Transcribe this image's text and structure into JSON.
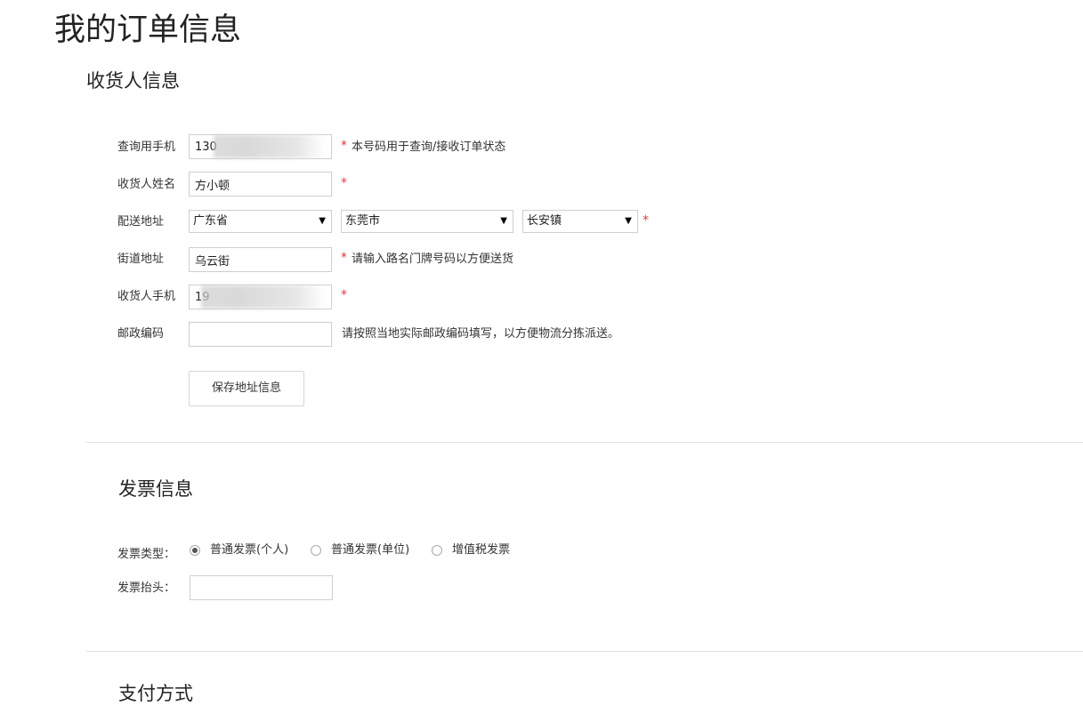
{
  "page_title": "我的订单信息",
  "receiver": {
    "section_title": "收货人信息",
    "query_phone": {
      "label": "查询用手机",
      "value": "130",
      "hint": "本号码用于查询/接收订单状态"
    },
    "name": {
      "label": "收货人姓名",
      "value": "方小顿"
    },
    "address": {
      "label": "配送地址",
      "province": "广东省",
      "city": "东莞市",
      "district": "长安镇"
    },
    "street": {
      "label": "街道地址",
      "value": "乌云街",
      "hint": "请输入路名门牌号码以方便送货"
    },
    "receiver_phone": {
      "label": "收货人手机",
      "value": "19"
    },
    "postcode": {
      "label": "邮政编码",
      "value": "",
      "hint": "请按照当地实际邮政编码填写，以方便物流分拣派送。"
    },
    "required_mark": "*",
    "save_button": "保存地址信息"
  },
  "invoice": {
    "section_title": "发票信息",
    "type_label": "发票类型：",
    "options": [
      {
        "label": "普通发票(个人)",
        "checked": true
      },
      {
        "label": "普通发票(单位)",
        "checked": false
      },
      {
        "label": "增值税发票",
        "checked": false
      }
    ],
    "header_label": "发票抬头：",
    "header_value": ""
  },
  "next_section_partial": "支付方式"
}
